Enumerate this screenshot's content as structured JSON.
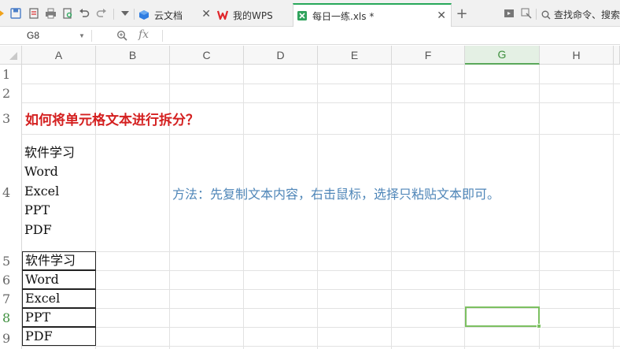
{
  "tabs": [
    {
      "label": "云文档",
      "icon": "cloud-doc-icon",
      "active": false
    },
    {
      "label": "我的WPS",
      "icon": "wps-logo-icon",
      "active": false
    },
    {
      "label": "每日一练.xls *",
      "icon": "spreadsheet-icon",
      "active": true
    }
  ],
  "search": {
    "label": "查找命令、搜索"
  },
  "formula_bar": {
    "name_box": "G8",
    "fx": "fx",
    "value": ""
  },
  "columns": [
    "A",
    "B",
    "C",
    "D",
    "E",
    "F",
    "G",
    "H"
  ],
  "selected_column": "G",
  "rows": [
    "1",
    "2",
    "3",
    "4",
    "5",
    "6",
    "7",
    "8",
    "9"
  ],
  "selected_row": "8",
  "cells": {
    "A3": "如何将单元格文本进行拆分？",
    "A4": [
      "软件学习",
      "Word",
      "Excel",
      "PPT",
      "PDF"
    ],
    "C4": "方法：先复制文本内容，右击鼠标，选择只粘贴文本即可。",
    "A5": "软件学习",
    "A6": "Word",
    "A7": "Excel",
    "A8": "PPT",
    "A9": "PDF"
  },
  "colors": {
    "title_red": "#d42020",
    "method_blue": "#4f86b8",
    "selection_green": "#7cc061",
    "active_tab_accent": "#27a85a"
  }
}
